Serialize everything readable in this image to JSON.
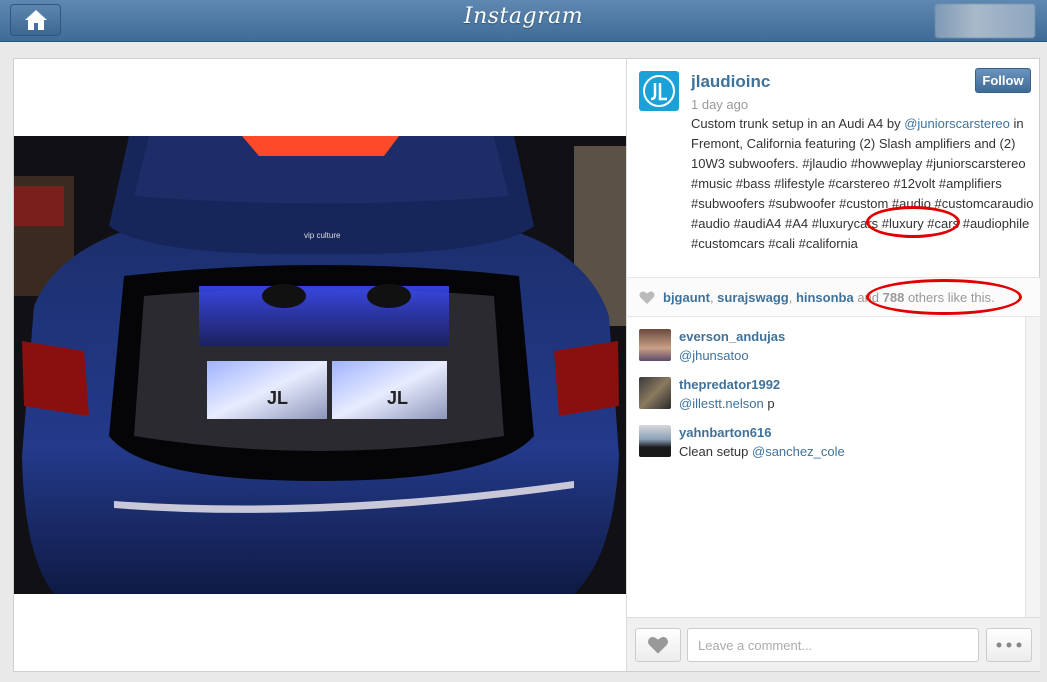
{
  "app": {
    "logo": "Instagram"
  },
  "post": {
    "username": "jlaudioinc",
    "time": "1 day ago",
    "follow_label": "Follow",
    "caption_prefix": "Custom trunk setup in an Audi A4 by ",
    "caption_mention": "@juniorscarstereo",
    "caption_rest": " in Fremont, California featuring (2) Slash amplifiers and (2) 10W3 subwoofers. #jlaudio #howweplay #juniorscarstereo #music #bass #lifestyle #carstereo #12volt #amplifiers #subwoofers #subwoofer #custom #audio #customcaraudio #audio #audiA4 #A4 #luxurycars #luxury #cars #audiophile #customcars #cali #california",
    "photo_text": "vip culture"
  },
  "likes": {
    "user1": "bjgaunt",
    "sep1": ", ",
    "user2": "surajswagg",
    "sep2": ", ",
    "user3": "hinsonba",
    "and": " and ",
    "count": "788",
    "suffix": " others like this."
  },
  "comments": [
    {
      "user": "everson_andujas",
      "mention": "@jhunsatoo",
      "text": ""
    },
    {
      "user": "thepredator1992",
      "mention": "@illestt.nelson",
      "text": " p"
    },
    {
      "user": "yahnbarton616",
      "prefix": "Clean setup ",
      "mention": "@sanchez_cole"
    }
  ],
  "footer": {
    "comment_placeholder": "Leave a comment..."
  },
  "colors": {
    "brand_blue": "#3f729b",
    "annotation_red": "#e00000",
    "author_avatar": "#1aa2d8"
  },
  "icons": [
    "home-icon",
    "heart-icon",
    "more-dots-icon",
    "jl-audio-logo"
  ]
}
